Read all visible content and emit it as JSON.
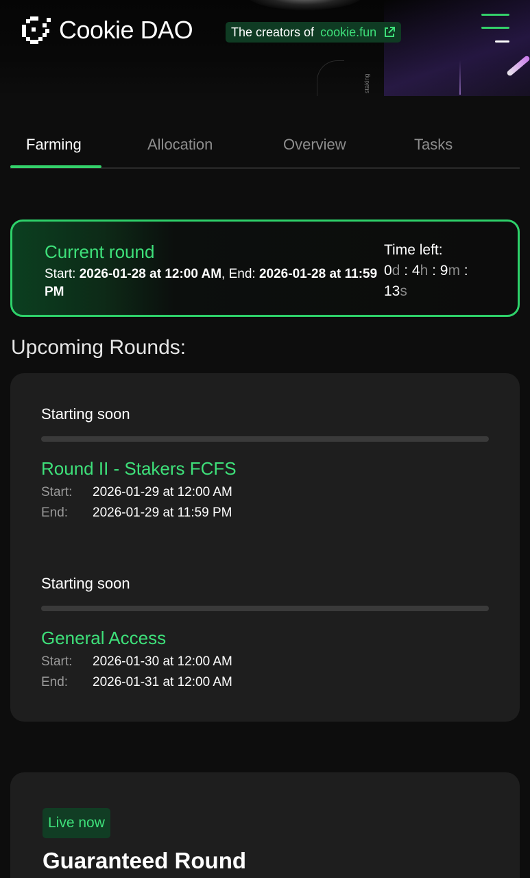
{
  "header": {
    "brand_name": "Cookie DAO",
    "creators_prefix": "The creators of",
    "creators_link": "cookie.fun",
    "staking_label": "staking",
    "accent_color": "#34d06a"
  },
  "tabs": [
    {
      "label": "Farming",
      "active": true
    },
    {
      "label": "Allocation",
      "active": false
    },
    {
      "label": "Overview",
      "active": false
    },
    {
      "label": "Tasks",
      "active": false
    }
  ],
  "current_round": {
    "title": "Current round",
    "start_label": "Start:",
    "start_value": "2026-01-28 at 12:00 AM",
    "end_label": "End:",
    "end_value": "2026-01-28 at 11:59 PM",
    "time_left_label": "Time left:",
    "days": "0",
    "hours": "4",
    "minutes": "9",
    "seconds": "13",
    "unit_d": "d",
    "unit_h": "h",
    "unit_m": "m",
    "unit_s": "s"
  },
  "upcoming": {
    "title": "Upcoming Rounds:",
    "rounds": [
      {
        "status": "Starting soon",
        "name": "Round II - Stakers FCFS",
        "start_label": "Start:",
        "start_value": "2026-01-29 at 12:00 AM",
        "end_label": "End:",
        "end_value": "2026-01-29 at 11:59 PM"
      },
      {
        "status": "Starting soon",
        "name": "General Access",
        "start_label": "Start:",
        "start_value": "2026-01-30 at 12:00 AM",
        "end_label": "End:",
        "end_value": "2026-01-31 at 12:00 AM"
      }
    ]
  },
  "guaranteed": {
    "badge": "Live now",
    "title": "Guaranteed Round"
  }
}
